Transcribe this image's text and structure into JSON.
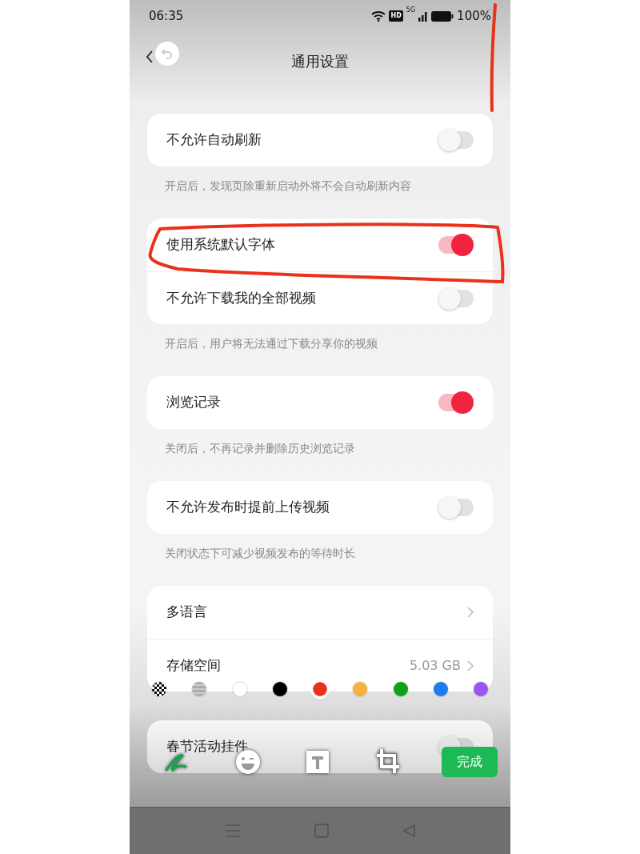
{
  "status_bar": {
    "time": "06:35",
    "badge": "HD",
    "network": "5G",
    "battery": "100%"
  },
  "header": {
    "title": "通用设置"
  },
  "groups": [
    {
      "rows": [
        {
          "kind": "toggle",
          "label": "不允许自动刷新",
          "on": false
        }
      ],
      "caption": "开启后，发现页除重新启动外将不会自动刷新内容"
    },
    {
      "rows": [
        {
          "kind": "toggle",
          "label": "使用系统默认字体",
          "on": true
        },
        {
          "kind": "toggle",
          "label": "不允许下载我的全部视频",
          "on": false
        }
      ],
      "caption": "开启后，用户将无法通过下载分享你的视频"
    },
    {
      "rows": [
        {
          "kind": "toggle",
          "label": "浏览记录",
          "on": true
        }
      ],
      "caption": "关闭后，不再记录并删除历史浏览记录"
    },
    {
      "rows": [
        {
          "kind": "toggle",
          "label": "不允许发布时提前上传视频",
          "on": false
        }
      ],
      "caption": "关闭状态下可减少视频发布的等待时长"
    },
    {
      "rows": [
        {
          "kind": "link",
          "label": "多语言"
        },
        {
          "kind": "link",
          "label": "存储空间",
          "value": "5.03 GB"
        }
      ]
    },
    {
      "rows": [
        {
          "kind": "toggle",
          "label": "春节活动挂件",
          "on": false
        }
      ]
    }
  ],
  "editor": {
    "swatches": [
      {
        "kind": "transparent",
        "selected": false
      },
      {
        "kind": "mosaic",
        "selected": false
      },
      {
        "kind": "color",
        "color": "#ffffff",
        "selected": false
      },
      {
        "kind": "color",
        "color": "#000000",
        "selected": false
      },
      {
        "kind": "color",
        "color": "#e8321c",
        "selected": true
      },
      {
        "kind": "color",
        "color": "#f5b23c",
        "selected": false
      },
      {
        "kind": "color",
        "color": "#0ea21a",
        "selected": false
      },
      {
        "kind": "color",
        "color": "#1e7bf0",
        "selected": false
      },
      {
        "kind": "color",
        "color": "#9b55f0",
        "selected": false
      }
    ],
    "tools": [
      {
        "kind": "pen",
        "selected": true
      },
      {
        "kind": "emoji",
        "selected": false
      },
      {
        "kind": "text",
        "selected": false
      },
      {
        "kind": "crop",
        "selected": false
      }
    ],
    "done": "完成"
  }
}
